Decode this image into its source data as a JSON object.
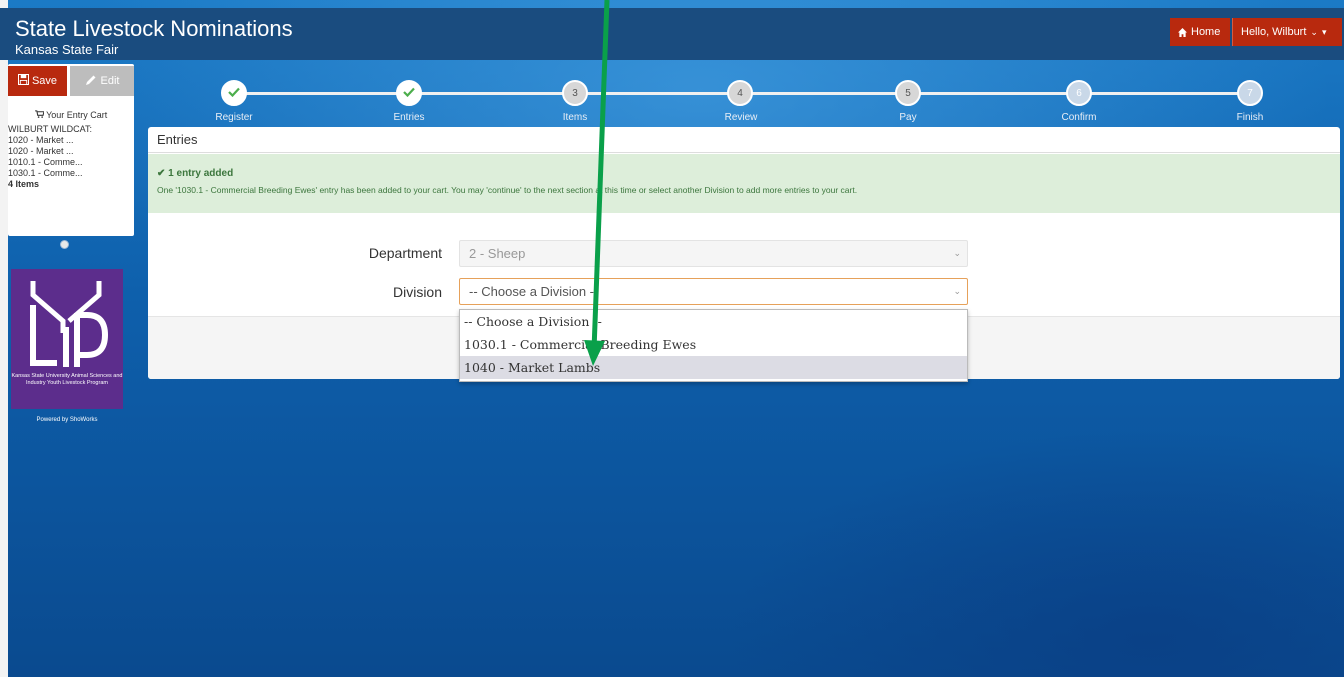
{
  "header": {
    "title": "State Livestock Nominations",
    "subtitle": "Kansas State Fair",
    "home_label": "Home",
    "user_label": "Hello, Wilburt"
  },
  "sidebar": {
    "save_label": "Save",
    "edit_label": "Edit",
    "cart_title": "Your Entry Cart",
    "cart_items": [
      "WILBURT WILDCAT:",
      "1020 - Market ...",
      "1020 - Market ...",
      "1010.1 - Comme...",
      "1030.1 - Comme..."
    ],
    "cart_count": "4 Items",
    "logo_text": "LYP",
    "logo_caption": "Kansas State University Animal Sciences and Industry Youth Livestock Program",
    "powered_by": "Powered by ShoWorks"
  },
  "stepper": {
    "steps": [
      {
        "label": "Register",
        "number": "1",
        "status": "done"
      },
      {
        "label": "Entries",
        "number": "2",
        "status": "done"
      },
      {
        "label": "Items",
        "number": "3",
        "status": "todo"
      },
      {
        "label": "Review",
        "number": "4",
        "status": "todo"
      },
      {
        "label": "Pay",
        "number": "5",
        "status": "todo"
      },
      {
        "label": "Confirm",
        "number": "6",
        "status": "faint"
      },
      {
        "label": "Finish",
        "number": "7",
        "status": "faint"
      }
    ]
  },
  "panel": {
    "heading": "Entries",
    "alert_title": "1 entry added",
    "alert_message": "One '1030.1 - Commercial Breeding Ewes' entry has been added to your cart. You may 'continue' to the next section at this time or select another Division to add more entries to your cart.",
    "department_label": "Department",
    "department_value": "2 - Sheep",
    "division_label": "Division",
    "division_value": "-- Choose a Division --"
  },
  "dropdown": {
    "options": [
      "-- Choose a Division --",
      "1030.1 - Commercial Breeding Ewes",
      "1040 - Market Lambs"
    ],
    "highlighted_index": 2
  },
  "colors": {
    "header_bg": "#1a4c7f",
    "accent_red": "#b8290e",
    "alert_green_bg": "#ddeeda",
    "logo_purple": "#5c2d8c",
    "annotation_arrow": "#0aa04a"
  }
}
